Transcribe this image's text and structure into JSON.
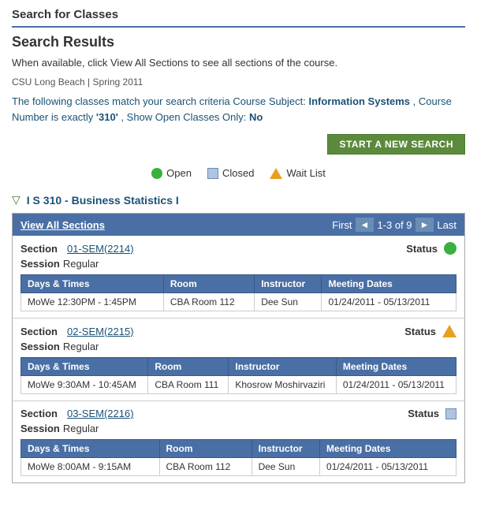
{
  "page": {
    "title": "Search for Classes",
    "section_heading": "Search Results",
    "description": "When available, click View All Sections to see all sections of the course.",
    "context": "CSU Long Beach | Spring 2011",
    "criteria_text_1": "The following classes match your search criteria Course Subject:",
    "criteria_subject": "Information Systems",
    "criteria_text_2": ", Course Number is exactly ",
    "criteria_number": "'310'",
    "criteria_text_3": ", Show Open Classes Only:",
    "criteria_open_only": "No"
  },
  "toolbar": {
    "start_new_search_label": "START A NEW SEARCH"
  },
  "legend": {
    "open_label": "Open",
    "closed_label": "Closed",
    "waitlist_label": "Wait List"
  },
  "course": {
    "arrow": "▽",
    "title": "I S 310 - Business Statistics I"
  },
  "sections_bar": {
    "view_all_label": "View All Sections",
    "first_label": "First",
    "last_label": "Last",
    "pagination": "1-3 of 9"
  },
  "sections": [
    {
      "id": "section-1",
      "section_label": "Section",
      "section_link": "01-SEM(2214)",
      "status_label": "Status",
      "status_type": "open",
      "session_label": "Session",
      "session_value": "Regular",
      "table": {
        "headers": [
          "Days & Times",
          "Room",
          "Instructor",
          "Meeting Dates"
        ],
        "rows": [
          [
            "MoWe 12:30PM - 1:45PM",
            "CBA  Room 112",
            "Dee Sun",
            "01/24/2011 - 05/13/2011"
          ]
        ]
      }
    },
    {
      "id": "section-2",
      "section_label": "Section",
      "section_link": "02-SEM(2215)",
      "status_label": "Status",
      "status_type": "waitlist",
      "session_label": "Session",
      "session_value": "Regular",
      "table": {
        "headers": [
          "Days & Times",
          "Room",
          "Instructor",
          "Meeting Dates"
        ],
        "rows": [
          [
            "MoWe 9:30AM - 10:45AM",
            "CBA  Room 111",
            "Khosrow Moshirvaziri",
            "01/24/2011 - 05/13/2011"
          ]
        ]
      }
    },
    {
      "id": "section-3",
      "section_label": "Section",
      "section_link": "03-SEM(2216)",
      "status_label": "Status",
      "status_type": "closed",
      "session_label": "Session",
      "session_value": "Regular",
      "table": {
        "headers": [
          "Days & Times",
          "Room",
          "Instructor",
          "Meeting Dates"
        ],
        "rows": [
          [
            "MoWe 8:00AM - 9:15AM",
            "CBA  Room 112",
            "Dee Sun",
            "01/24/2011 - 05/13/2011"
          ]
        ]
      }
    }
  ]
}
